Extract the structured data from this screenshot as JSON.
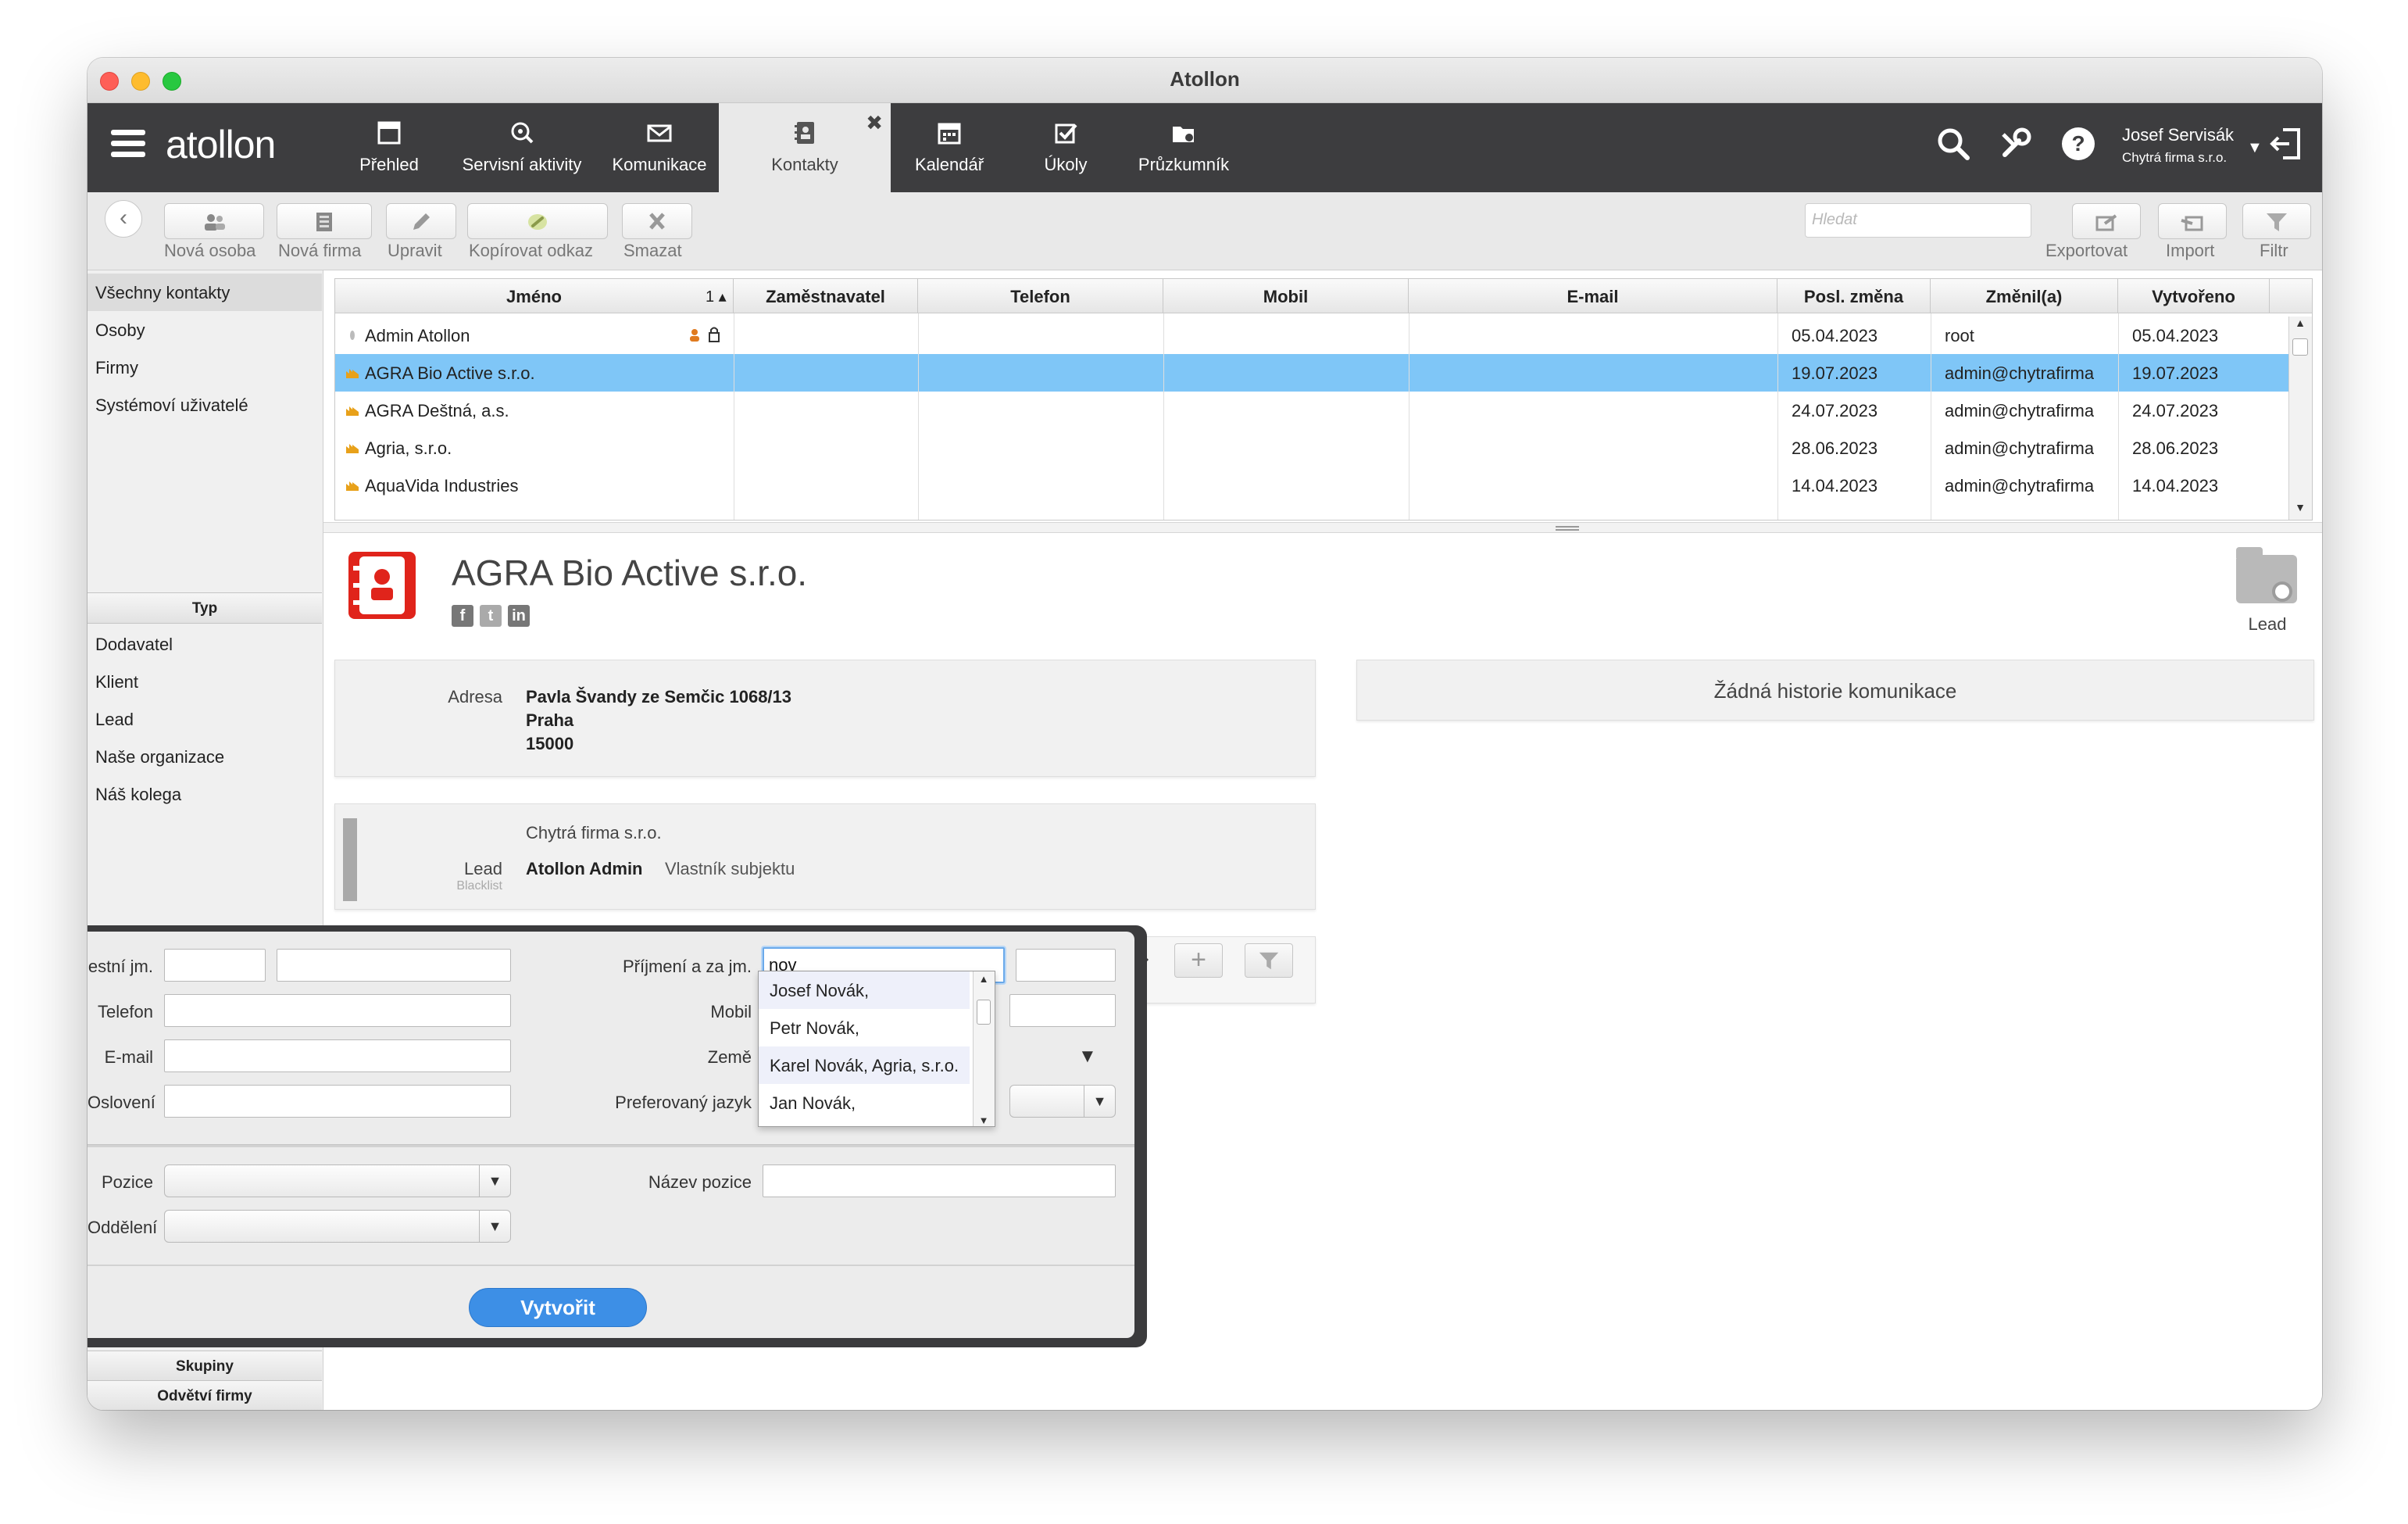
{
  "window": {
    "title": "Atollon"
  },
  "nav": {
    "logo": "atollon",
    "items": [
      {
        "label": "Přehled",
        "icon": "overview-icon"
      },
      {
        "label": "Servisní aktivity",
        "icon": "service-activities-icon"
      },
      {
        "label": "Komunikace",
        "icon": "communication-icon"
      },
      {
        "label": "Kontakty",
        "icon": "contacts-icon"
      },
      {
        "label": "Kalendář",
        "icon": "calendar-icon"
      },
      {
        "label": "Úkoly",
        "icon": "tasks-icon"
      },
      {
        "label": "Průzkumník",
        "icon": "explorer-icon"
      }
    ],
    "close_glyph": "✖",
    "user_name": "Josef Servisák",
    "user_company": "Chytrá firma s.r.o."
  },
  "toolbar": {
    "new_person": "Nová osoba",
    "new_company": "Nová firma",
    "edit": "Upravit",
    "copy_link": "Kopírovat odkaz",
    "delete": "Smazat",
    "search_placeholder": "Hledat",
    "export": "Exportovat",
    "import": "Import",
    "filter": "Filtr"
  },
  "sidebar": {
    "items": [
      "Všechny kontakty",
      "Osoby",
      "Firmy",
      "Systémoví uživatelé"
    ],
    "type_header": "Typ",
    "types": [
      "Dodavatel",
      "Klient",
      "Lead",
      "Naše organizace",
      "Náš kolega"
    ],
    "groups_header": "Skupiny",
    "industries_header": "Odvětví firmy"
  },
  "table": {
    "columns": [
      "Jméno",
      "Zaměstnavatel",
      "Telefon",
      "Mobil",
      "E-mail",
      "Posl. změna",
      "Změnil(a)",
      "Vytvořeno"
    ],
    "sort_indicator": "1 ▴",
    "rows": [
      {
        "name": "Admin Atollon",
        "changed": "05.04.2023",
        "by": "root",
        "created": "05.04.2023",
        "selected": false
      },
      {
        "name": "AGRA Bio Active s.r.o.",
        "changed": "19.07.2023",
        "by": "admin@chytrafirma",
        "created": "19.07.2023",
        "selected": true
      },
      {
        "name": "AGRA Deštná, a.s.",
        "changed": "24.07.2023",
        "by": "admin@chytrafirma",
        "created": "24.07.2023",
        "selected": false
      },
      {
        "name": "Agria, s.r.o.",
        "changed": "28.06.2023",
        "by": "admin@chytrafirma",
        "created": "28.06.2023",
        "selected": false
      },
      {
        "name": "AquaVida Industries",
        "changed": "14.04.2023",
        "by": "admin@chytrafirma",
        "created": "14.04.2023",
        "selected": false
      }
    ]
  },
  "detail": {
    "company_name": "AGRA Bio Active s.r.o.",
    "lead_label": "Lead",
    "address_label": "Adresa",
    "address_lines": [
      "Pavla Švandy ze Semčic 1068/13",
      "Praha",
      "15000"
    ],
    "owner_company": "Chytrá firma s.r.o.",
    "status_label": "Lead",
    "blacklist_label": "Blacklist",
    "owner_name": "Atollon Admin",
    "owner_role": "Vlastník subjektu",
    "no_history": "Žádná historie komunikace"
  },
  "form": {
    "title_label": "estní jm.",
    "phone_label": "Telefon",
    "email_label": "E-mail",
    "salutation_label": "Oslovení",
    "surname_label": "Příjmení a za jm.",
    "surname_value": "nov",
    "mobile_label": "Mobil",
    "country_label": "Země",
    "language_label": "Preferovaný jazyk",
    "position_label": "Pozice",
    "department_label": "Oddělení",
    "position_name_label": "Název pozice",
    "create_button": "Vytvořit"
  },
  "autocomplete": {
    "options": [
      "Josef Novák,",
      "Petr Novák,",
      "Karel Novák, Agria, s.r.o.",
      "Jan Novák,"
    ],
    "highlighted_index": 2
  },
  "colors": {
    "navbar": "#3d3d3f",
    "selection": "#7fc6f7",
    "accent_red": "#e0241b",
    "button_blue": "#3d8fe6"
  }
}
